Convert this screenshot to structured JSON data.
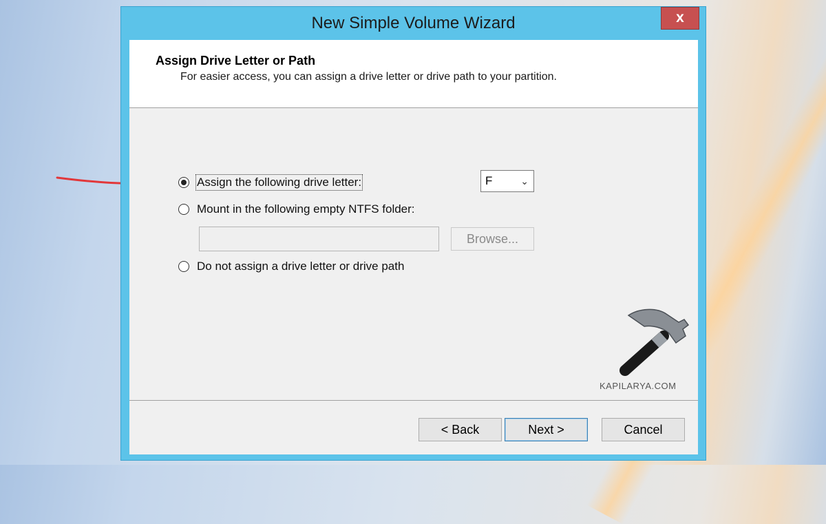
{
  "window": {
    "title": "New Simple Volume Wizard",
    "close_glyph": "x"
  },
  "header": {
    "title": "Assign Drive Letter or Path",
    "subtitle": "For easier access, you can assign a drive letter or drive path to your partition."
  },
  "options": [
    {
      "label": "Assign the following drive letter:",
      "checked": true
    },
    {
      "label": "Mount in the following empty NTFS folder:",
      "checked": false
    },
    {
      "label": "Do not assign a drive letter or drive path",
      "checked": false
    }
  ],
  "drive_letter": {
    "value": "F",
    "arrow": "⌄"
  },
  "folder_path": {
    "value": ""
  },
  "buttons": {
    "browse": "Browse...",
    "back": "< Back",
    "next": "Next >",
    "cancel": "Cancel"
  },
  "watermark": {
    "text": "KAPILARYA.COM"
  },
  "colors": {
    "title_bar": "#5cc3e9",
    "close_button": "#c75050",
    "annotation_arrow": "#e2373a"
  }
}
